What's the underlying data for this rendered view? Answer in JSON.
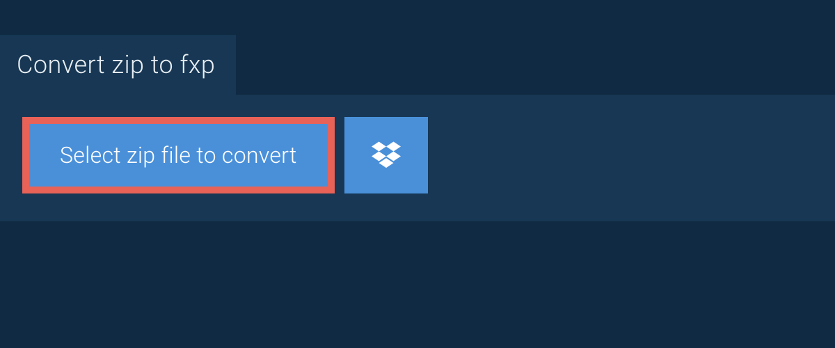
{
  "header": {
    "title": "Convert zip to fxp"
  },
  "actions": {
    "select_file_label": "Select zip file to convert"
  },
  "colors": {
    "background_dark": "#0f2a42",
    "panel": "#173754",
    "button_primary": "#4a90d9",
    "highlight_border": "#e86258"
  }
}
